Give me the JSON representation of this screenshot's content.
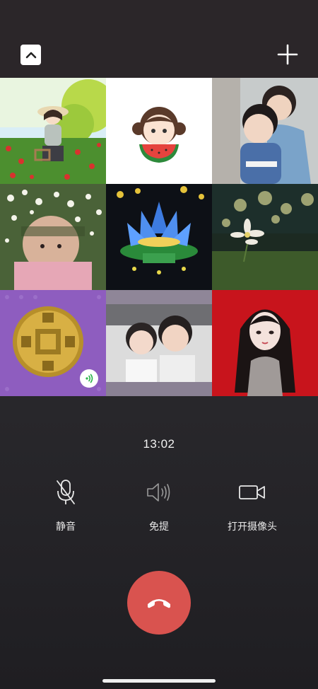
{
  "header": {
    "collapse_icon": "chevron-up-icon",
    "add_icon": "plus-icon"
  },
  "participants": [
    {
      "name": "participant-1",
      "image": "girl-in-flower-field-illustration"
    },
    {
      "name": "participant-2",
      "image": "girl-eating-watermelon-illustration"
    },
    {
      "name": "participant-3",
      "image": "mother-and-baby-photo"
    },
    {
      "name": "participant-4",
      "image": "child-with-flower-crown-photo"
    },
    {
      "name": "participant-5",
      "image": "glowing-lotus-lantern-photo"
    },
    {
      "name": "participant-6",
      "image": "white-flower-bokeh-photo"
    },
    {
      "name": "participant-7",
      "image": "gold-coin-photo",
      "speaking": true
    },
    {
      "name": "participant-8",
      "image": "two-girls-selfie-photo"
    },
    {
      "name": "participant-9",
      "image": "girl-portrait-illustration"
    }
  ],
  "call": {
    "duration": "13:02"
  },
  "controls": {
    "mute_label": "静音",
    "speaker_label": "免提",
    "camera_label": "打开摄像头"
  },
  "colors": {
    "hangup": "#d9534f",
    "speaking_indicator": "#2bb24c"
  }
}
